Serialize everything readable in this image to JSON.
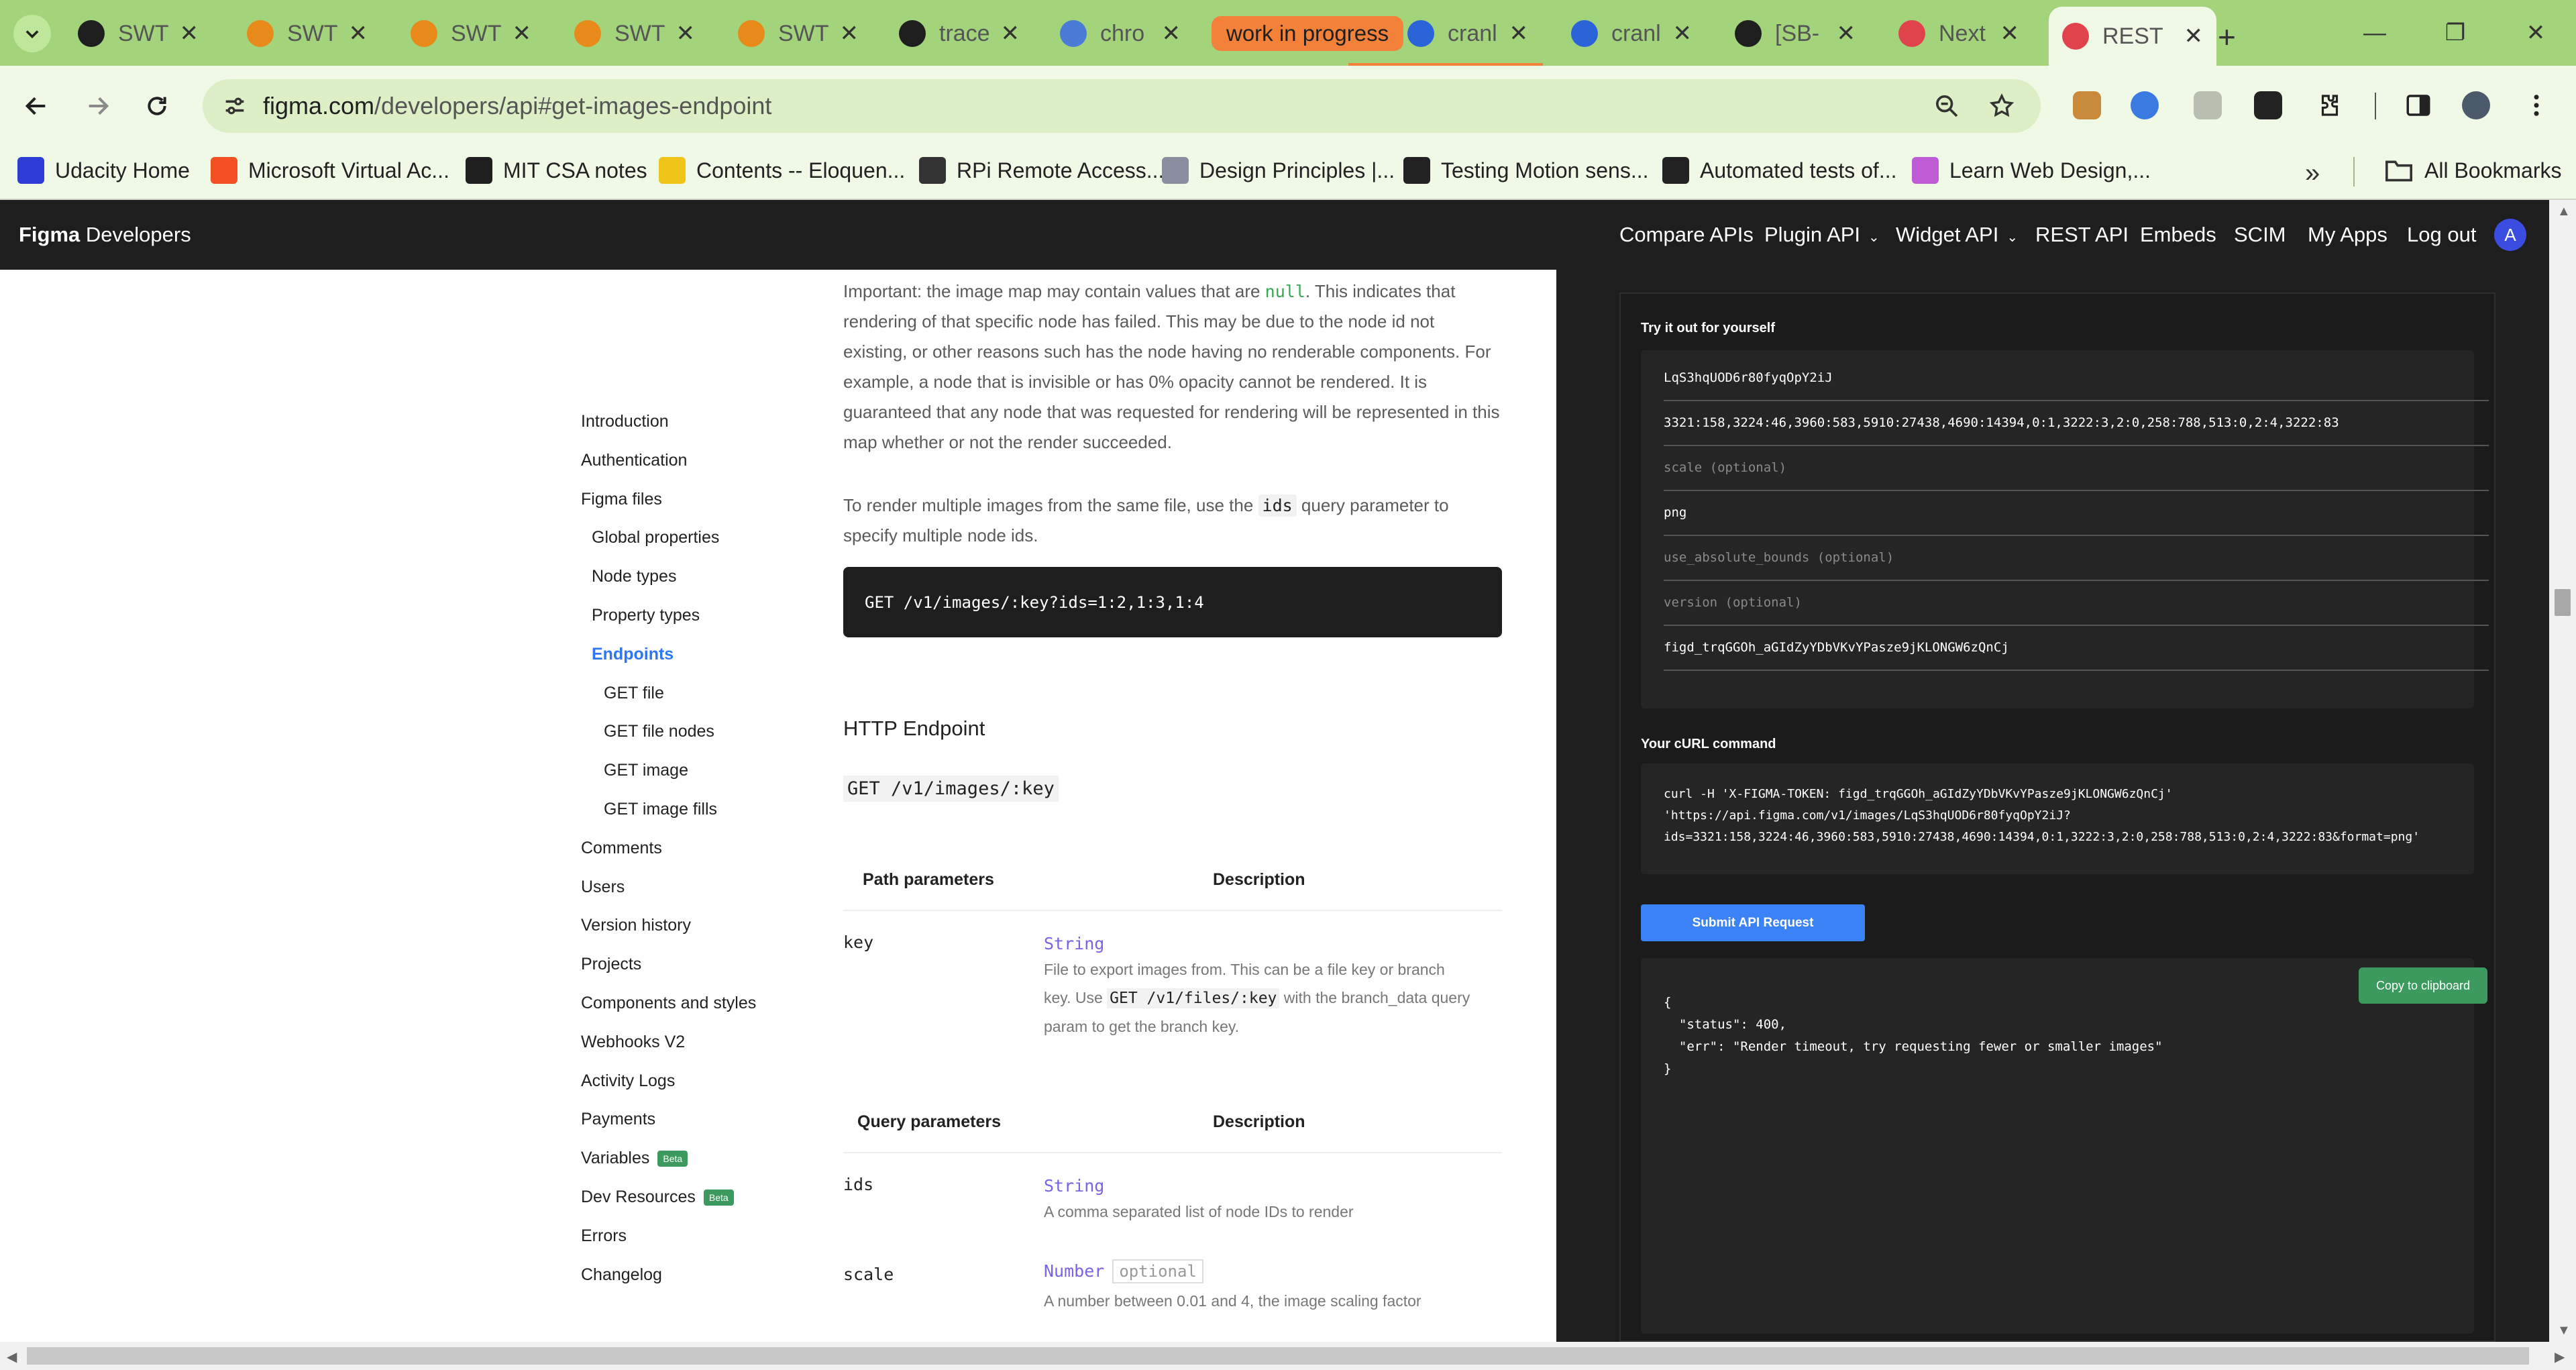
{
  "browser": {
    "tabs": [
      {
        "title": "SWT",
        "favicon": "github-icon",
        "color": "#1f1f1f"
      },
      {
        "title": "SWT",
        "favicon": "ef-icon",
        "color": "#e88a1a"
      },
      {
        "title": "SWT",
        "favicon": "ef-icon",
        "color": "#e88a1a"
      },
      {
        "title": "SWT",
        "favicon": "ef-icon",
        "color": "#e88a1a"
      },
      {
        "title": "SWT",
        "favicon": "ef-icon",
        "color": "#e88a1a"
      },
      {
        "title": "trace",
        "favicon": "github-icon",
        "color": "#1f1f1f"
      },
      {
        "title": "chro",
        "favicon": "chromium-icon",
        "color": "#4a7bd6"
      },
      {
        "title": "cranl",
        "favicon": "bookmark-blue-icon",
        "color": "#2b63d9"
      },
      {
        "title": "cranl",
        "favicon": "bookmark-blue-icon",
        "color": "#2b63d9"
      },
      {
        "title": "[SB-",
        "favicon": "s-icon",
        "color": "#1f1f1f"
      },
      {
        "title": "Next",
        "favicon": "figma-icon",
        "color": "#e0434b"
      },
      {
        "title": "REST",
        "favicon": "figma-icon",
        "color": "#e0434b",
        "active": true
      }
    ],
    "tab_group_label": "work in progress",
    "close_glyph": "✕",
    "new_tab_glyph": "+",
    "window": {
      "minimize": "—",
      "restore": "❐",
      "close": "✕"
    },
    "address": {
      "host": "figma.com",
      "path": "/developers/api#get-images-endpoint"
    },
    "bookmarks": [
      {
        "label": "Udacity Home",
        "icon": "udacity-icon",
        "color": "#2e3dd6"
      },
      {
        "label": "Microsoft Virtual Ac...",
        "icon": "microsoft-icon",
        "color": "#f25022"
      },
      {
        "label": "MIT CSA notes",
        "icon": "mit-icon",
        "color": "#1f1f1f"
      },
      {
        "label": "Contents -- Eloquen...",
        "icon": "ejs-icon",
        "color": "#f0c419"
      },
      {
        "label": "RPi Remote Access...",
        "icon": "linux-icon",
        "color": "#333333"
      },
      {
        "label": "Design Principles |...",
        "icon": "design-icon",
        "color": "#8a8fa0"
      },
      {
        "label": "Testing Motion sens...",
        "icon": "star-bookmark-icon",
        "color": "#222222"
      },
      {
        "label": "Automated tests of...",
        "icon": "circle-c-icon",
        "color": "#222222"
      },
      {
        "label": "Learn Web Design,...",
        "icon": "webdesign-icon",
        "color": "#c05bd6"
      }
    ],
    "bookmarks_more": "»",
    "all_bookmarks": "All Bookmarks"
  },
  "figma": {
    "brand_bold": "Figma",
    "brand_rest": " Developers",
    "nav": [
      {
        "label": "Compare APIs",
        "dropdown": false
      },
      {
        "label": "Plugin API",
        "dropdown": true
      },
      {
        "label": "Widget API",
        "dropdown": true
      },
      {
        "label": "REST API",
        "dropdown": false
      },
      {
        "label": "Embeds",
        "dropdown": false
      },
      {
        "label": "SCIM",
        "dropdown": false
      },
      {
        "label": "My Apps",
        "dropdown": false
      },
      {
        "label": "Log out",
        "dropdown": false
      }
    ],
    "avatar_letter": "A",
    "dropdown_glyph": "⌄"
  },
  "sidebar": [
    {
      "label": "Introduction",
      "level": 0
    },
    {
      "label": "Authentication",
      "level": 0
    },
    {
      "label": "Figma files",
      "level": 0
    },
    {
      "label": "Global properties",
      "level": 1
    },
    {
      "label": "Node types",
      "level": 1
    },
    {
      "label": "Property types",
      "level": 1
    },
    {
      "label": "Endpoints",
      "level": 1,
      "active": true
    },
    {
      "label": "GET file",
      "level": 2
    },
    {
      "label": "GET file nodes",
      "level": 2
    },
    {
      "label": "GET image",
      "level": 2
    },
    {
      "label": "GET image fills",
      "level": 2
    },
    {
      "label": "Comments",
      "level": 0
    },
    {
      "label": "Users",
      "level": 0
    },
    {
      "label": "Version history",
      "level": 0
    },
    {
      "label": "Projects",
      "level": 0
    },
    {
      "label": "Components and styles",
      "level": 0
    },
    {
      "label": "Webhooks V2",
      "level": 0
    },
    {
      "label": "Activity Logs",
      "level": 0
    },
    {
      "label": "Payments",
      "level": 0
    },
    {
      "label": "Variables",
      "level": 0,
      "badge": "Beta"
    },
    {
      "label": "Dev Resources",
      "level": 0,
      "badge": "Beta"
    },
    {
      "label": "Errors",
      "level": 0
    },
    {
      "label": "Changelog",
      "level": 0
    }
  ],
  "content": {
    "important_p1_a": "Important: the image map may contain values that are ",
    "important_null": "null",
    "important_p1_b": ". This indicates that rendering of that specific node has failed. This may be due to the node id not existing, or other reasons such has the node having no renderable components. For example, a node that is invisible or has 0% opacity cannot be rendered. It is guaranteed that any node that was requested for rendering will be represented in this map whether or not the render succeeded.",
    "multi_a": "To render multiple images from the same file, use the ",
    "multi_code": "ids",
    "multi_b": " query parameter to specify multiple node ids.",
    "code_example": "GET /v1/images/:key?ids=1:2,1:3,1:4",
    "http_heading": "HTTP Endpoint",
    "endpoint": "GET /v1/images/:key",
    "path_params_header": "Path parameters",
    "query_params_header": "Query parameters",
    "description_header": "Description",
    "key_name": "key",
    "key_type": "String",
    "key_desc_a": "File to export images from. This can be a file key or branch key. Use ",
    "key_desc_code": "GET /v1/files/:key",
    "key_desc_b": " with the branch_data query param to get the branch key.",
    "ids_name": "ids",
    "ids_type": "String",
    "ids_desc": "A comma separated list of node IDs to render",
    "scale_name": "scale",
    "scale_type": "Number",
    "scale_optional": "optional",
    "scale_desc": "A number between 0.01 and 4, the image scaling factor"
  },
  "tryit": {
    "heading": "Try it out for yourself",
    "fields": [
      {
        "value": "LqS3hqUOD6r80fyqOpY2iJ",
        "placeholder": false
      },
      {
        "value": "3321:158,3224:46,3960:583,5910:27438,4690:14394,0:1,3222:3,2:0,258:788,513:0,2:4,3222:83",
        "placeholder": false
      },
      {
        "value": "scale (optional)",
        "placeholder": true
      },
      {
        "value": "png",
        "placeholder": false
      },
      {
        "value": "use_absolute_bounds (optional)",
        "placeholder": true
      },
      {
        "value": "version (optional)",
        "placeholder": true
      },
      {
        "value": "figd_trqGGOh_aGIdZyYDbVKvYPasze9jKLONGW6zQnCj",
        "placeholder": false
      }
    ],
    "curl_heading": "Your cURL command",
    "curl_line1": "curl -H 'X-FIGMA-TOKEN: figd_trqGGOh_aGIdZyYDbVKvYPasze9jKLONGW6zQnCj'",
    "curl_line2": "'https://api.figma.com/v1/images/LqS3hqUOD6r80fyqOpY2iJ?",
    "curl_line3": "ids=3321:158,3224:46,3960:583,5910:27438,4690:14394,0:1,3222:3,2:0,258:788,513:0,2:4,3222:83&format=png'",
    "submit_label": "Submit API Request",
    "copy_label": "Copy to clipboard",
    "response": "{\n  \"status\": 400,\n  \"err\": \"Render timeout, try requesting fewer or smaller images\"\n}"
  }
}
